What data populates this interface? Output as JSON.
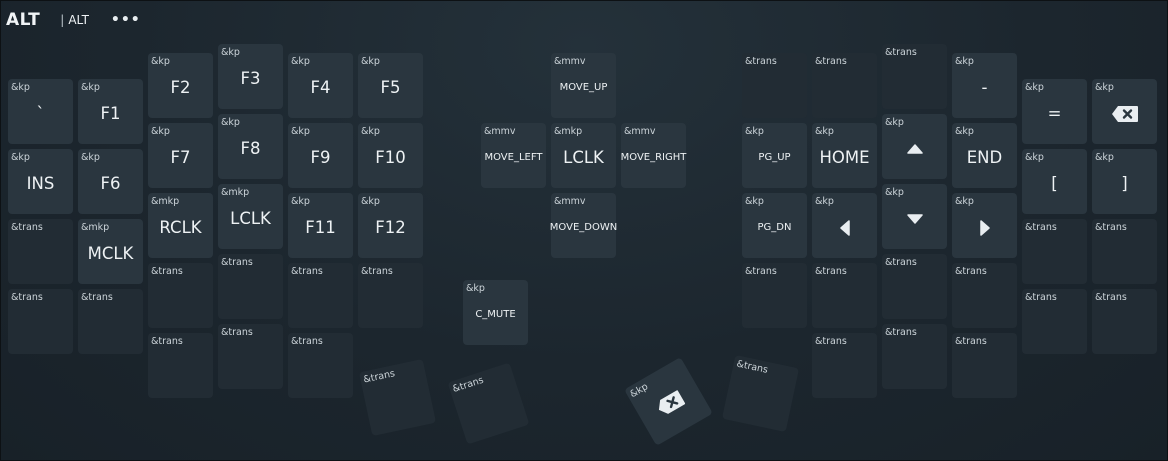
{
  "header": {
    "title": "ALT",
    "separator": "|",
    "layer_tab": "ALT",
    "more_label": "•••"
  },
  "keys": [
    {
      "id": "k0",
      "b": "&kp",
      "v": "`"
    },
    {
      "id": "k1",
      "b": "&kp",
      "v": "F1"
    },
    {
      "id": "k2",
      "b": "&kp",
      "v": "F2"
    },
    {
      "id": "k3",
      "b": "&kp",
      "v": "F3"
    },
    {
      "id": "k4",
      "b": "&kp",
      "v": "F4"
    },
    {
      "id": "k5",
      "b": "&kp",
      "v": "F5"
    },
    {
      "id": "k6",
      "b": "&mmv",
      "v": "MOVE_UP"
    },
    {
      "id": "k7",
      "b": "&trans",
      "v": ""
    },
    {
      "id": "k8",
      "b": "&trans",
      "v": ""
    },
    {
      "id": "k9",
      "b": "&trans",
      "v": ""
    },
    {
      "id": "k10",
      "b": "&kp",
      "v": "-"
    },
    {
      "id": "k11",
      "b": "&kp",
      "v": "="
    },
    {
      "id": "k12",
      "b": "&kp",
      "v": "",
      "icon": "backspace-icon"
    },
    {
      "id": "k13",
      "b": "&kp",
      "v": "INS"
    },
    {
      "id": "k14",
      "b": "&kp",
      "v": "F6"
    },
    {
      "id": "k15",
      "b": "&kp",
      "v": "F7"
    },
    {
      "id": "k16",
      "b": "&kp",
      "v": "F8"
    },
    {
      "id": "k17",
      "b": "&kp",
      "v": "F9"
    },
    {
      "id": "k18",
      "b": "&kp",
      "v": "F10"
    },
    {
      "id": "k19",
      "b": "&mmv",
      "v": "MOVE_LEFT"
    },
    {
      "id": "k20",
      "b": "&mkp",
      "v": "LCLK"
    },
    {
      "id": "k21",
      "b": "&mmv",
      "v": "MOVE_RIGHT"
    },
    {
      "id": "k22",
      "b": "&kp",
      "v": "PG_UP"
    },
    {
      "id": "k23",
      "b": "&kp",
      "v": "HOME"
    },
    {
      "id": "k24",
      "b": "&kp",
      "v": "",
      "icon": "arrow-up-icon"
    },
    {
      "id": "k25",
      "b": "&kp",
      "v": "END"
    },
    {
      "id": "k26",
      "b": "&kp",
      "v": "["
    },
    {
      "id": "k27",
      "b": "&kp",
      "v": "]"
    },
    {
      "id": "k28",
      "b": "&trans",
      "v": ""
    },
    {
      "id": "k29",
      "b": "&mkp",
      "v": "MCLK"
    },
    {
      "id": "k30",
      "b": "&mkp",
      "v": "RCLK"
    },
    {
      "id": "k31",
      "b": "&mkp",
      "v": "LCLK"
    },
    {
      "id": "k32",
      "b": "&kp",
      "v": "F11"
    },
    {
      "id": "k33",
      "b": "&kp",
      "v": "F12"
    },
    {
      "id": "k34",
      "b": "&mmv",
      "v": "MOVE_DOWN"
    },
    {
      "id": "k35",
      "b": "&kp",
      "v": "PG_DN"
    },
    {
      "id": "k36",
      "b": "&kp",
      "v": "",
      "icon": "arrow-left-icon"
    },
    {
      "id": "k37",
      "b": "&kp",
      "v": "",
      "icon": "arrow-down-icon"
    },
    {
      "id": "k38",
      "b": "&kp",
      "v": "",
      "icon": "arrow-right-icon"
    },
    {
      "id": "k39",
      "b": "&trans",
      "v": ""
    },
    {
      "id": "k40",
      "b": "&trans",
      "v": ""
    },
    {
      "id": "k41",
      "b": "&trans",
      "v": ""
    },
    {
      "id": "k42",
      "b": "&trans",
      "v": ""
    },
    {
      "id": "k43",
      "b": "&trans",
      "v": ""
    },
    {
      "id": "k44",
      "b": "&trans",
      "v": ""
    },
    {
      "id": "k45",
      "b": "&trans",
      "v": ""
    },
    {
      "id": "k46",
      "b": "&kp",
      "v": "C_MUTE"
    },
    {
      "id": "k47",
      "b": "&trans",
      "v": ""
    },
    {
      "id": "k48",
      "b": "&trans",
      "v": ""
    },
    {
      "id": "k49",
      "b": "&trans",
      "v": ""
    },
    {
      "id": "k50",
      "b": "&trans",
      "v": ""
    },
    {
      "id": "k51",
      "b": "&trans",
      "v": ""
    },
    {
      "id": "k52",
      "b": "&trans",
      "v": ""
    },
    {
      "id": "k53",
      "b": "&trans",
      "v": ""
    },
    {
      "id": "k54",
      "b": "&trans",
      "v": ""
    },
    {
      "id": "k55",
      "b": "&trans",
      "v": ""
    },
    {
      "id": "k56",
      "b": "&trans",
      "v": ""
    },
    {
      "id": "k57",
      "b": "&trans",
      "v": ""
    },
    {
      "id": "k58",
      "b": "&trans",
      "v": ""
    },
    {
      "id": "k59",
      "b": "&trans",
      "v": ""
    },
    {
      "id": "k60",
      "b": "&trans",
      "v": ""
    },
    {
      "id": "k61",
      "b": "&trans",
      "v": ""
    },
    {
      "id": "k62",
      "b": "&kp",
      "v": "",
      "icon": "backspace-icon"
    },
    {
      "id": "k63",
      "b": "&trans",
      "v": ""
    }
  ]
}
